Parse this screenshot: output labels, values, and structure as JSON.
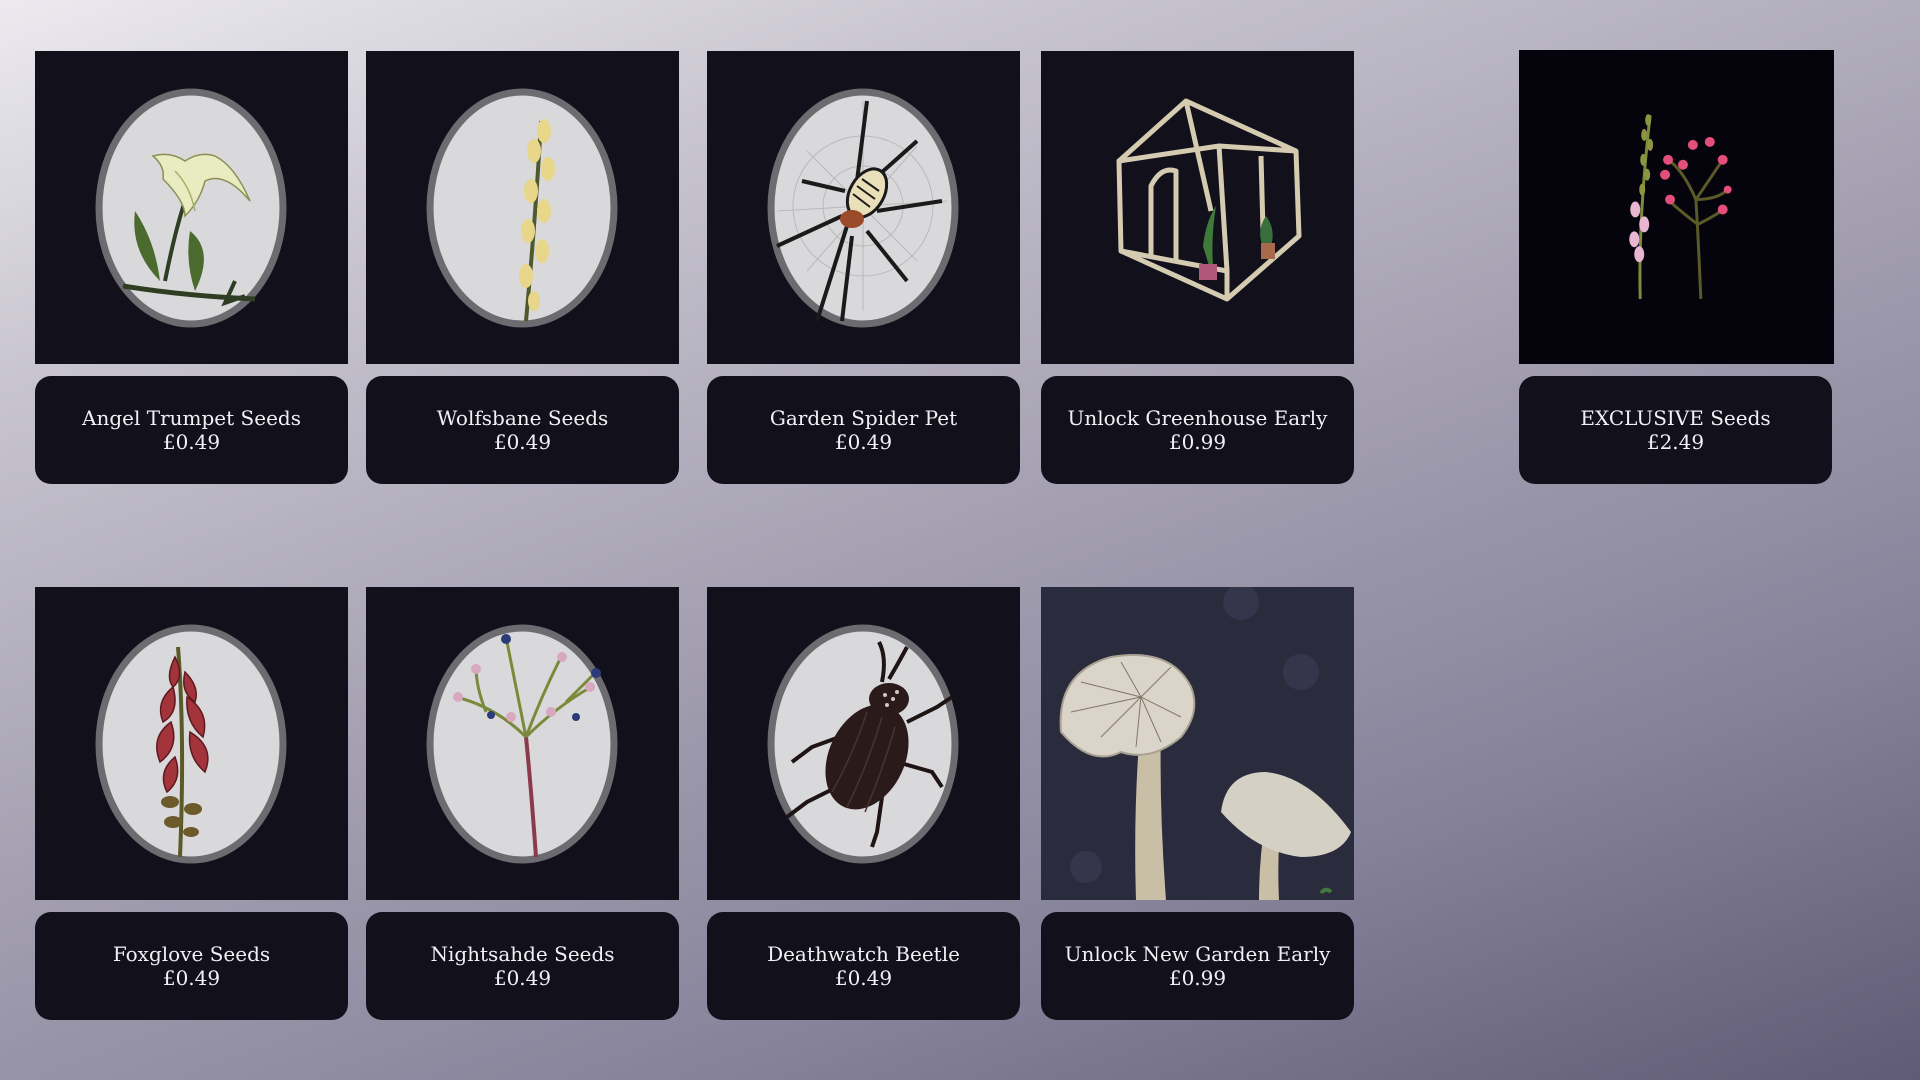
{
  "shop": {
    "items": [
      {
        "name": "Angel Trumpet Seeds",
        "price": "£0.49",
        "icon": "angel-trumpet-illustration"
      },
      {
        "name": "Wolfsbane Seeds",
        "price": "£0.49",
        "icon": "wolfsbane-illustration"
      },
      {
        "name": "Garden Spider Pet",
        "price": "£0.49",
        "icon": "garden-spider-illustration"
      },
      {
        "name": "Unlock Greenhouse Early",
        "price": "£0.99",
        "icon": "greenhouse-illustration"
      },
      {
        "name": "EXCLUSIVE Seeds",
        "price": "£2.49",
        "icon": "exclusive-flowers-illustration"
      },
      {
        "name": "Foxglove Seeds",
        "price": "£0.49",
        "icon": "foxglove-illustration"
      },
      {
        "name": "Nightsahde Seeds",
        "price": "£0.49",
        "icon": "nightshade-illustration"
      },
      {
        "name": "Deathwatch Beetle",
        "price": "£0.49",
        "icon": "deathwatch-beetle-illustration"
      },
      {
        "name": "Unlock New Garden Early",
        "price": "£0.99",
        "icon": "mushroom-garden-illustration"
      }
    ]
  },
  "colors": {
    "card_background": "#11101b",
    "card_text": "#f1f0f5",
    "oval_fill": "#d9d9db",
    "oval_border": "#6b6b70"
  }
}
